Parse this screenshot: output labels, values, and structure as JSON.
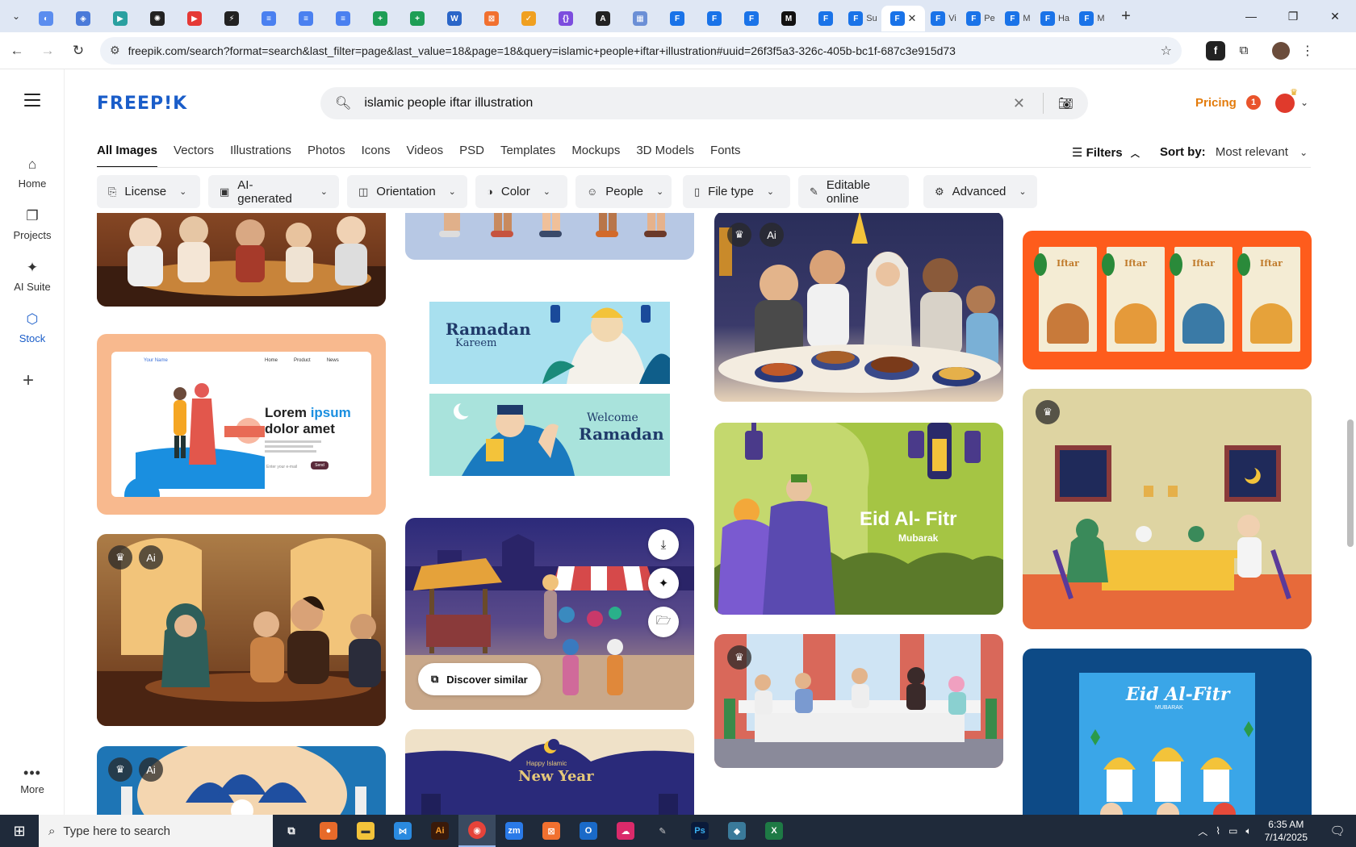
{
  "browser": {
    "tabs": [
      {
        "icon": "grid-icon",
        "color": "#5b8def",
        "glyph": "◐"
      },
      {
        "icon": "shield-icon",
        "color": "#4a7ad9",
        "glyph": "◈"
      },
      {
        "icon": "drive-icon",
        "color": "#2aa0a0",
        "glyph": "▶"
      },
      {
        "icon": "openai-icon",
        "color": "#222222",
        "glyph": "✺"
      },
      {
        "icon": "youtube-icon",
        "color": "#e53935",
        "glyph": "▶"
      },
      {
        "icon": "bolt-icon",
        "color": "#222222",
        "glyph": "⚡"
      },
      {
        "icon": "docs-icon",
        "color": "#4a80f0",
        "glyph": "≡"
      },
      {
        "icon": "docs-icon",
        "color": "#4a80f0",
        "glyph": "≡"
      },
      {
        "icon": "docs-icon",
        "color": "#4a80f0",
        "glyph": "≡"
      },
      {
        "icon": "sheets-icon",
        "color": "#1e9e55",
        "glyph": "+"
      },
      {
        "icon": "sheets-icon",
        "color": "#1e9e55",
        "glyph": "+"
      },
      {
        "icon": "word-icon",
        "color": "#2b66c8",
        "glyph": "W"
      },
      {
        "icon": "app-icon",
        "color": "#f1702f",
        "glyph": "⊠"
      },
      {
        "icon": "extension-icon",
        "color": "#f0a020",
        "glyph": "✓"
      },
      {
        "icon": "code-icon",
        "color": "#7c4dde",
        "glyph": "{}"
      },
      {
        "icon": "adobe-icon",
        "color": "#222222",
        "glyph": "A"
      },
      {
        "icon": "app-icon",
        "color": "#6b8fd6",
        "glyph": "▦"
      },
      {
        "icon": "docs-icon",
        "color": "#1a73e8",
        "glyph": "F"
      },
      {
        "icon": "docs-icon",
        "color": "#1a73e8",
        "glyph": "F"
      },
      {
        "icon": "docs-icon",
        "color": "#1a73e8",
        "glyph": "F"
      },
      {
        "icon": "medium-icon",
        "color": "#111111",
        "glyph": "M"
      },
      {
        "icon": "docs-icon",
        "color": "#1a73e8",
        "glyph": "F"
      }
    ],
    "tab_su": "Su",
    "tab_vi": "Vi",
    "tab_pe": "Pe",
    "tab_m": "M",
    "tab_h": "Ha",
    "tab_m2": "M",
    "url": "freepik.com/search?format=search&last_filter=page&last_value=18&page=18&query=islamic+people+iftar+illustration#uuid=26f3f5a3-326c-405b-bc1f-687c3e915d73"
  },
  "rail": {
    "home": "Home",
    "projects": "Projects",
    "ai_suite": "AI Suite",
    "stock": "Stock",
    "more": "More"
  },
  "header": {
    "logo": "FREEP!K",
    "search_value": "islamic people iftar illustration",
    "pricing": "Pricing",
    "notif_count": "1"
  },
  "categories": [
    "All Images",
    "Vectors",
    "Illustrations",
    "Photos",
    "Icons",
    "Videos",
    "PSD",
    "Templates",
    "Mockups",
    "3D Models",
    "Fonts"
  ],
  "toolbar": {
    "filters": "Filters",
    "sort_label": "Sort by:",
    "sort_value": "Most relevant"
  },
  "chips": [
    "License",
    "AI-generated",
    "Orientation",
    "Color",
    "People",
    "File type",
    "Editable online",
    "Advanced"
  ],
  "cards": {
    "lorem_line1": "Lorem",
    "lorem_ipsum": "ipsum",
    "lorem_line2": "dolor amet",
    "lorem_brand": "Your Name",
    "lorem_nav": [
      "Home",
      "Product",
      "News"
    ],
    "lorem_button": "Send",
    "lorem_input": "Enter your e-mail",
    "ramadan_kareem_1": "Ramadan",
    "ramadan_kareem_2": "Kareem",
    "welcome": "Welcome",
    "ramadan": "Ramadan",
    "eid_title": "Eid Al- Fitr",
    "eid_sub": "Mubarak",
    "eid2_title": "Eid Al-Fitr",
    "eid2_sub": "MUBARAK",
    "iftar_label": "Iftar",
    "newyear_1": "Happy Islamic",
    "newyear_2": "New Year",
    "discover": "Discover similar"
  },
  "taskbar": {
    "search_placeholder": "Type here to search",
    "time": "6:35 AM",
    "date": "7/14/2025"
  }
}
